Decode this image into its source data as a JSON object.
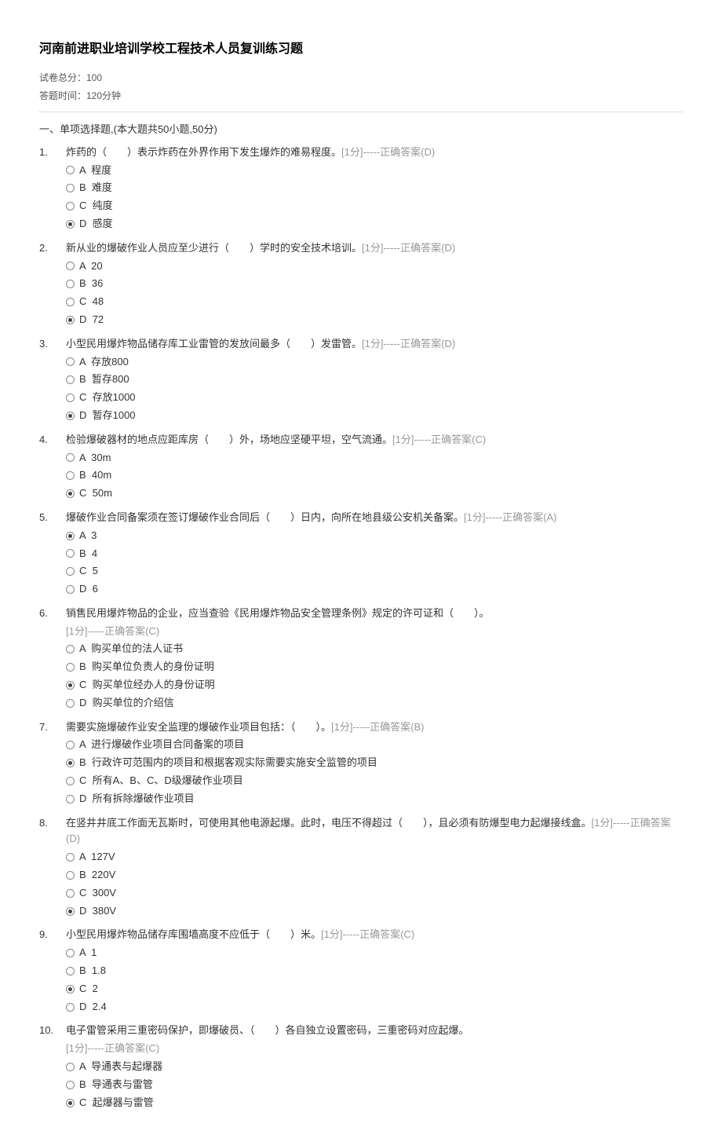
{
  "title": "河南前进职业培训学校工程技术人员复训练习题",
  "meta": {
    "total_score": "试卷总分：100",
    "time_limit": "答题时间：120分钟"
  },
  "section_title": "一、单项选择题,(本大题共50小题,50分)",
  "answer_prefix": "-----正确答案",
  "score_label": "[1分]",
  "questions": [
    {
      "num": "1.",
      "text": "炸药的（　　）表示炸药在外界作用下发生爆炸的难易程度。",
      "answer": "(D)",
      "options": [
        {
          "label": "A  程度",
          "selected": false
        },
        {
          "label": "B  难度",
          "selected": false
        },
        {
          "label": "C  纯度",
          "selected": false
        },
        {
          "label": "D  感度",
          "selected": true
        }
      ]
    },
    {
      "num": "2.",
      "text": "新从业的爆破作业人员应至少进行（　　）学时的安全技术培训。",
      "answer": "(D)",
      "options": [
        {
          "label": "A  20",
          "selected": false
        },
        {
          "label": "B  36",
          "selected": false
        },
        {
          "label": "C  48",
          "selected": false
        },
        {
          "label": "D  72",
          "selected": true
        }
      ]
    },
    {
      "num": "3.",
      "text": "小型民用爆炸物品储存库工业雷管的发放间最多（　　）发雷管。",
      "answer": "(D)",
      "options": [
        {
          "label": "A  存放800",
          "selected": false
        },
        {
          "label": "B  暂存800",
          "selected": false
        },
        {
          "label": "C  存放1000",
          "selected": false
        },
        {
          "label": "D  暂存1000",
          "selected": true
        }
      ]
    },
    {
      "num": "4.",
      "text": "检验爆破器材的地点应距库房（　　）外，场地应坚硬平坦，空气流通。",
      "answer": "(C)",
      "options": [
        {
          "label": "A  30m",
          "selected": false
        },
        {
          "label": "B  40m",
          "selected": false
        },
        {
          "label": "C  50m",
          "selected": true
        }
      ]
    },
    {
      "num": "5.",
      "text": "爆破作业合同备案须在签订爆破作业合同后（　　）日内，向所在地县级公安机关备案。",
      "answer": "(A)",
      "options": [
        {
          "label": "A  3",
          "selected": true
        },
        {
          "label": "B  4",
          "selected": false
        },
        {
          "label": "C  5",
          "selected": false
        },
        {
          "label": "D  6",
          "selected": false
        }
      ]
    },
    {
      "num": "6.",
      "text": "销售民用爆炸物品的企业，应当查验《民用爆炸物品安全管理条例》规定的许可证和（　　）。",
      "answer": "(C)",
      "wrap_answer": true,
      "options": [
        {
          "label": "A  购买单位的法人证书",
          "selected": false
        },
        {
          "label": "B  购买单位负责人的身份证明",
          "selected": false
        },
        {
          "label": "C  购买单位经办人的身份证明",
          "selected": true
        },
        {
          "label": "D  购买单位的介绍信",
          "selected": false
        }
      ]
    },
    {
      "num": "7.",
      "text": "需要实施爆破作业安全监理的爆破作业项目包括：（　　）。",
      "answer": "(B)",
      "options": [
        {
          "label": "A  进行爆破作业项目合同备案的项目",
          "selected": false
        },
        {
          "label": "B  行政许可范围内的项目和根据客观实际需要实施安全监管的项目",
          "selected": true
        },
        {
          "label": "C  所有A、B、C、D级爆破作业项目",
          "selected": false
        },
        {
          "label": "D  所有拆除爆破作业项目",
          "selected": false
        }
      ]
    },
    {
      "num": "8.",
      "text_pre": "在竖井井底工作面无瓦斯时，可使用其他电源起爆。此时，电压不得超过（　　），且必须有防爆型电力起爆接线盒。",
      "answer": "(D)",
      "wrap_answer_inline": true,
      "options": [
        {
          "label": "A  127V",
          "selected": false
        },
        {
          "label": "B  220V",
          "selected": false
        },
        {
          "label": "C  300V",
          "selected": false
        },
        {
          "label": "D  380V",
          "selected": true
        }
      ]
    },
    {
      "num": "9.",
      "text": "小型民用爆炸物品储存库围墙高度不应低于（　　）米。",
      "answer": "(C)",
      "options": [
        {
          "label": "A  1",
          "selected": false
        },
        {
          "label": "B  1.8",
          "selected": false
        },
        {
          "label": "C  2",
          "selected": true
        },
        {
          "label": "D  2.4",
          "selected": false
        }
      ]
    },
    {
      "num": "10.",
      "text": "电子雷管采用三重密码保护，即爆破员、（　　）各自独立设置密码，三重密码对应起爆。",
      "answer": "(C)",
      "wrap_answer": true,
      "options": [
        {
          "label": "A  导通表与起爆器",
          "selected": false
        },
        {
          "label": "B  导通表与雷管",
          "selected": false
        },
        {
          "label": "C  起爆器与雷管",
          "selected": true
        }
      ]
    }
  ]
}
